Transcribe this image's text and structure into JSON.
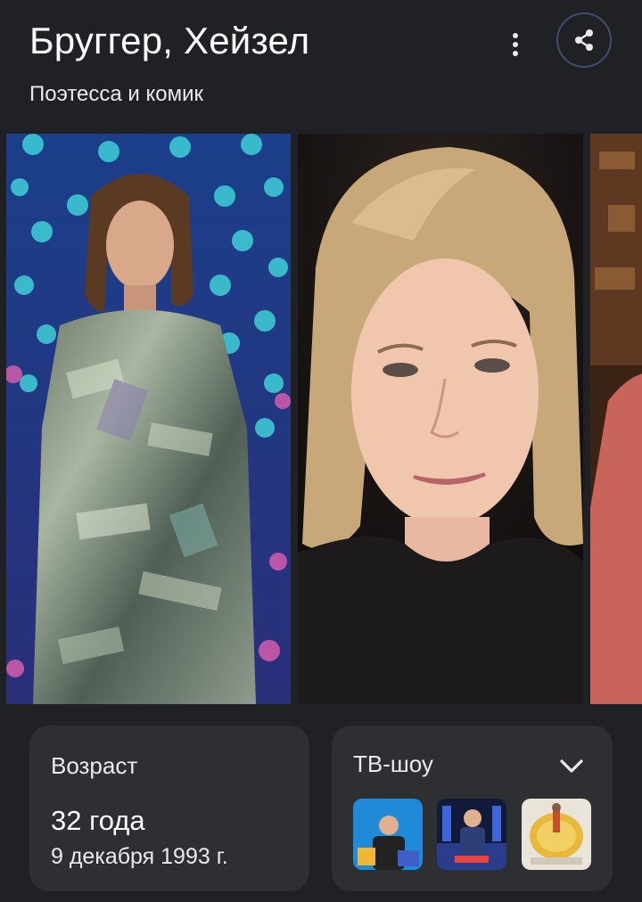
{
  "header": {
    "title": "Бруггер, Хейзел",
    "subtitle": "Поэтесса и комик",
    "more_icon": "more-vert-icon",
    "share_icon": "share-icon"
  },
  "gallery": {
    "photos": [
      "photo-stage-performance",
      "photo-portrait",
      "photo-partial"
    ]
  },
  "age_card": {
    "label": "Возраст",
    "value": "32 года",
    "birth_date": "9 декабря 1993 г."
  },
  "tv_card": {
    "label": "ТВ-шоу",
    "expand_icon": "chevron-down-icon",
    "thumbnails": [
      "tv-show-1",
      "tv-show-2",
      "tv-show-3"
    ]
  },
  "colors": {
    "background": "#202124",
    "card": "#2d2f33",
    "share_border": "#3c4f6e",
    "text": "#e8eaed"
  }
}
